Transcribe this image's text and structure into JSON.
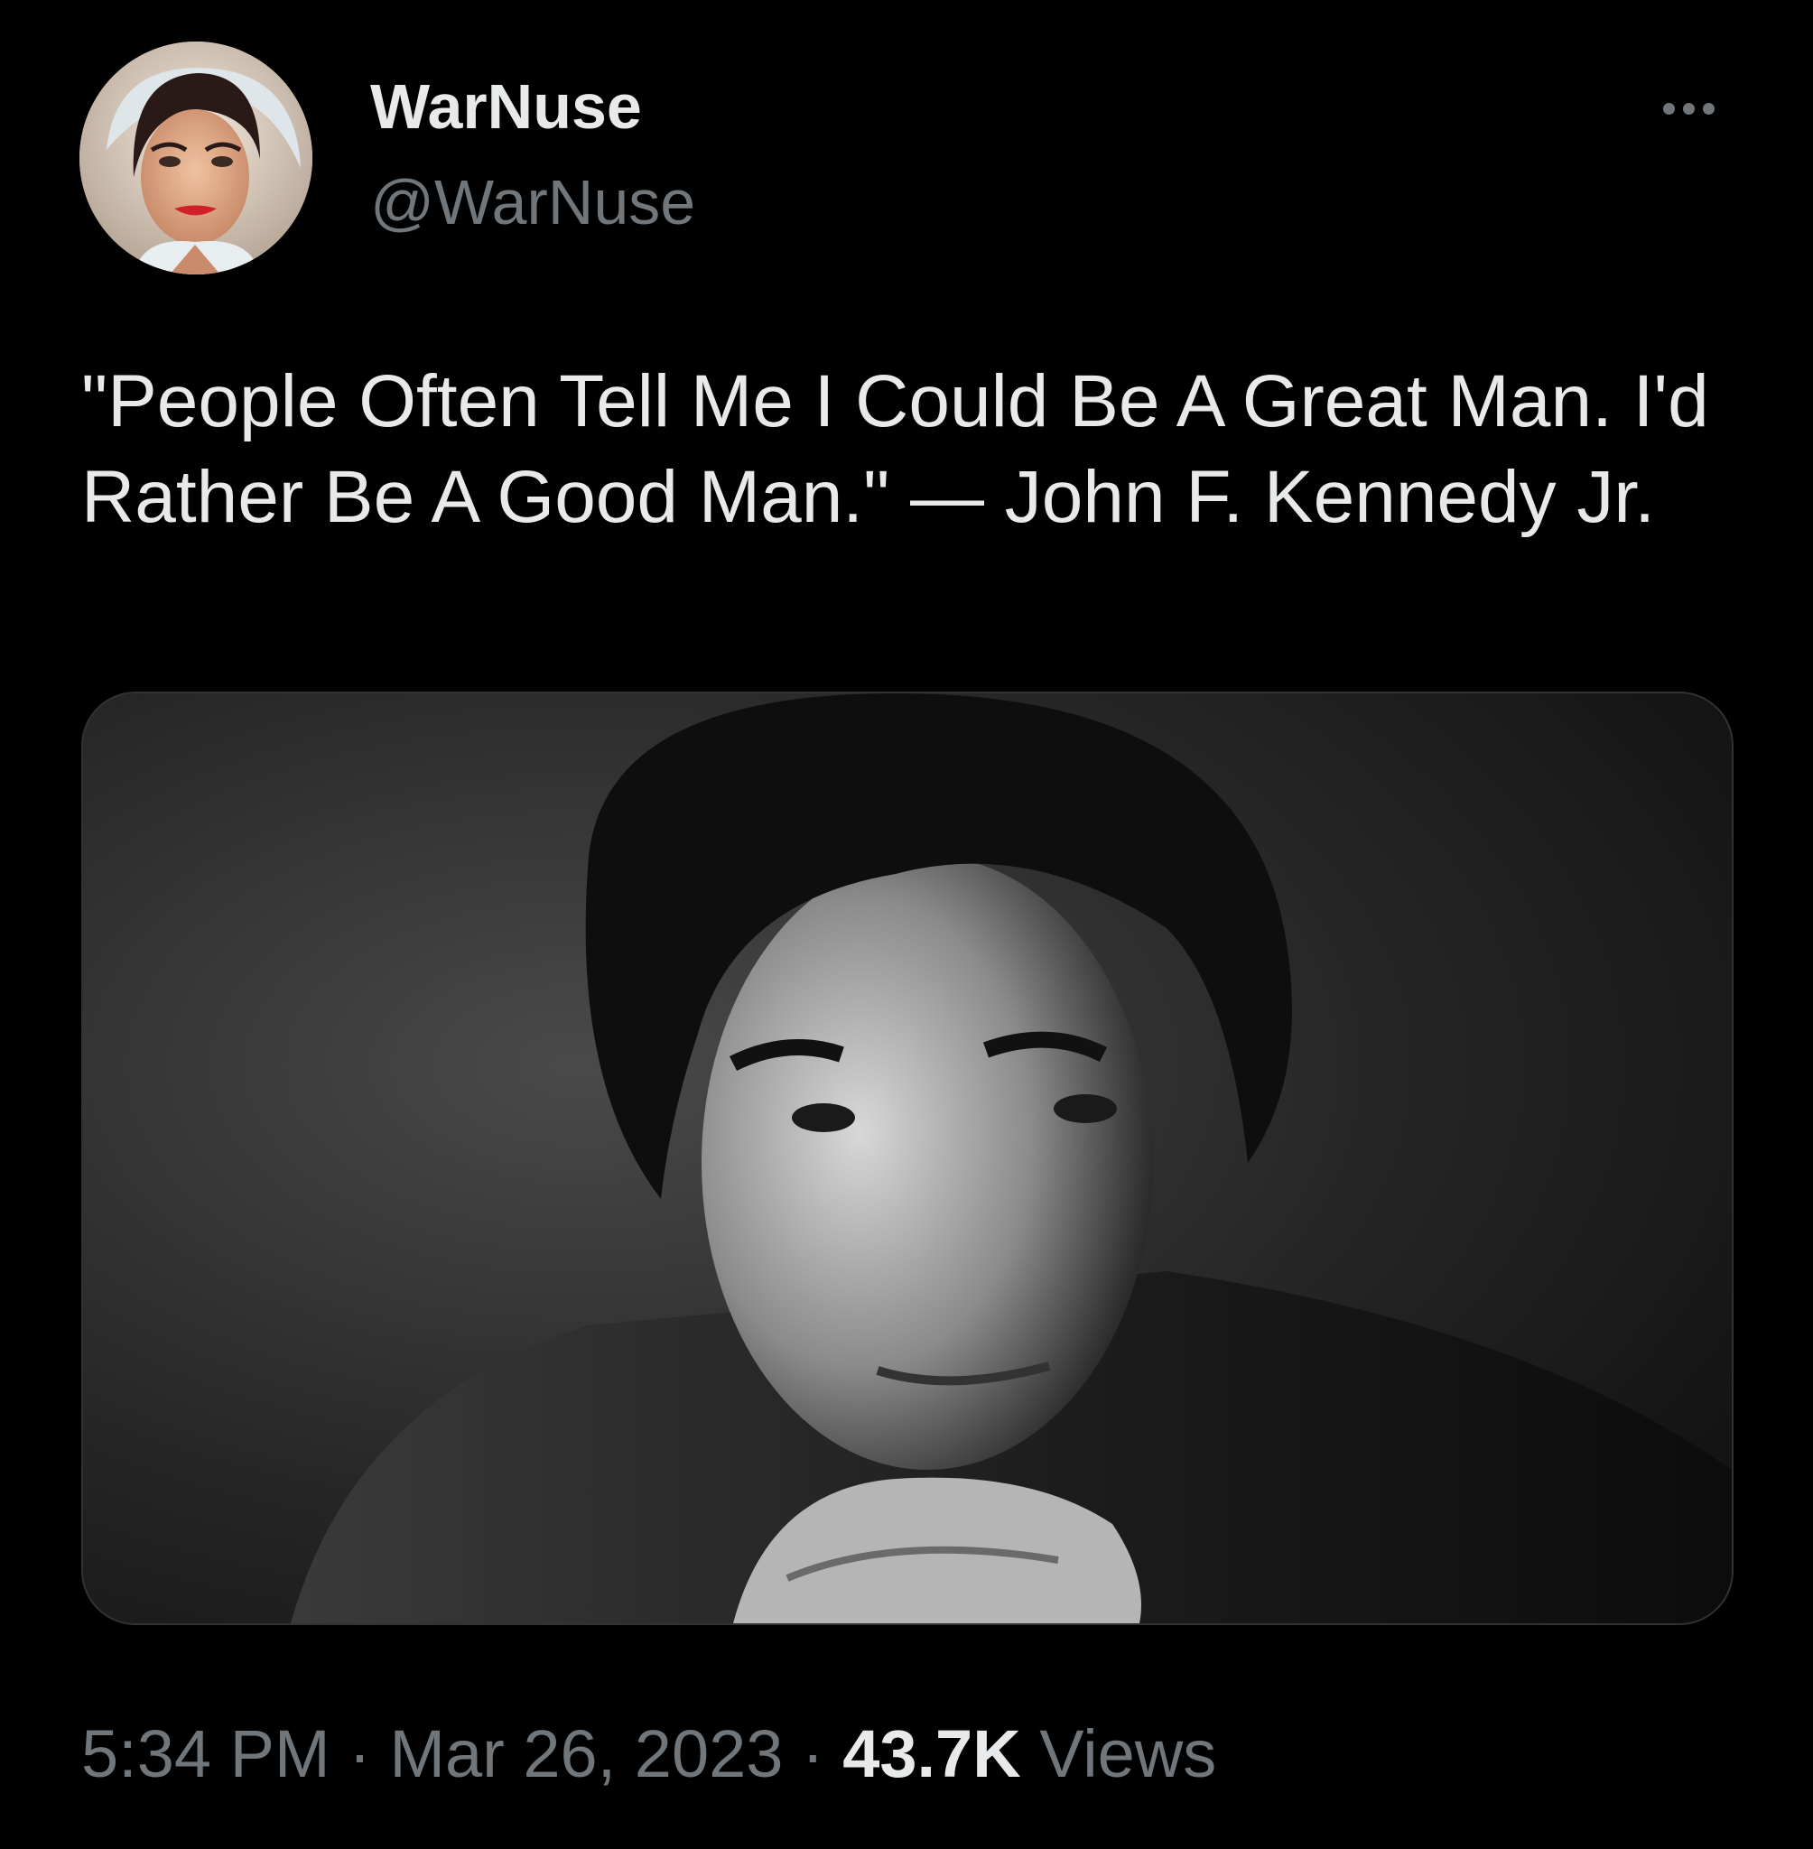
{
  "author": {
    "display_name": "WarNuse",
    "handle": "@WarNuse",
    "avatar_icon": "pinup-portrait-avatar"
  },
  "menu": {
    "more_icon": "more-horizontal-icon"
  },
  "tweet": {
    "text": "\"People Often Tell Me I Could Be A Great Man. I'd Rather Be A Good Man.\" — John F. Kennedy Jr.",
    "media_description_icon": "black-and-white-portrait-photo"
  },
  "meta": {
    "time": "5:34 PM",
    "separator": " · ",
    "date": "Mar 26, 2023",
    "views_count": "43.7K",
    "views_label": " Views"
  },
  "colors": {
    "background": "#000000",
    "primary_text": "#e7e9ea",
    "secondary_text": "#71767b",
    "border": "#2f3336"
  }
}
